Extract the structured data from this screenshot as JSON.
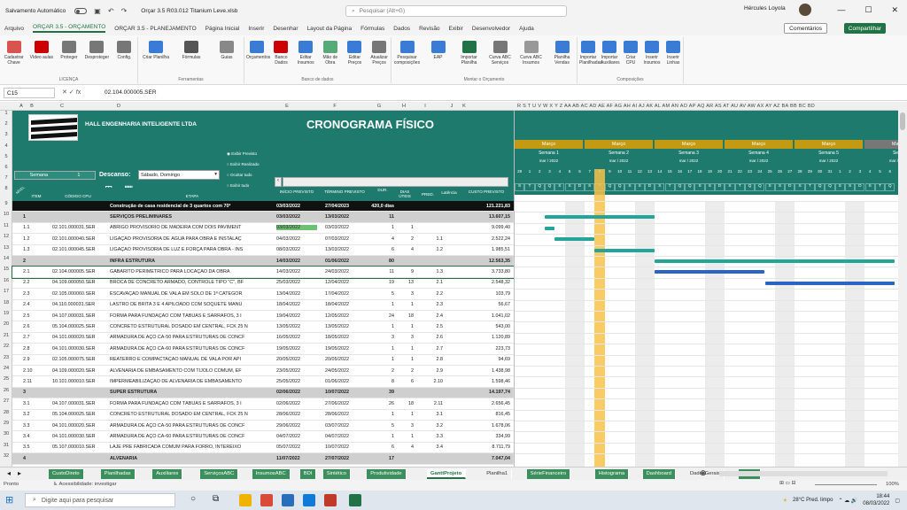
{
  "titlebar": {
    "autosave": "Salvamento Automático",
    "file": "Orçar 3.5 R03.012 Titanium Leve.xlsb",
    "search_placeholder": "Pesquisar (Alt+G)",
    "user": "Hércules Loyola"
  },
  "menu": [
    "Arquivo",
    "ORÇAR 3.5 - ORÇAMENTO",
    "ORÇAR 3.5 - PLANEJAMENTO",
    "Página Inicial",
    "Inserir",
    "Desenhar",
    "Layout da Página",
    "Fórmulas",
    "Dados",
    "Revisão",
    "Exibir",
    "Desenvolvedor",
    "Ajuda"
  ],
  "menu_active": 1,
  "comments": "Comentários",
  "share": "Compartilhar",
  "ribbon": {
    "buttons": [
      {
        "l": "Cadastrar Chave",
        "c": "#d9534f"
      },
      {
        "l": "Vídeo aulas",
        "c": "#c00"
      },
      {
        "l": "Proteger",
        "c": "#777"
      },
      {
        "l": "Desproteger",
        "c": "#777"
      },
      {
        "l": "Config.",
        "c": "#777"
      },
      {
        "l": "Criar Planilha",
        "c": "#3a7bd5"
      },
      {
        "l": "Fórmulas",
        "c": "#555"
      },
      {
        "l": "Guias",
        "c": "#888"
      },
      {
        "l": "Orçamentos",
        "c": "#3a7bd5"
      },
      {
        "l": "Banco Dados",
        "c": "#c00"
      },
      {
        "l": "Editar Insumos",
        "c": "#3a7bd5"
      },
      {
        "l": "Mão de Obra",
        "c": "#5a7"
      },
      {
        "l": "Editar Preços",
        "c": "#3a7bd5"
      },
      {
        "l": "Atualizar Preços",
        "c": "#777"
      },
      {
        "l": "Pesquisar composições",
        "c": "#3a7bd5"
      },
      {
        "l": "EAP",
        "c": "#3a7bd5"
      },
      {
        "l": "Importar Planilha",
        "c": "#217346"
      },
      {
        "l": "Curva ABC Serviços",
        "c": "#777"
      },
      {
        "l": "Curva ABC Insumos",
        "c": "#999"
      },
      {
        "l": "Planilha Vendas",
        "c": "#3a7bd5"
      },
      {
        "l": "Importar Planilhadas",
        "c": "#3a7bd5"
      },
      {
        "l": "Importar Auxiliares",
        "c": "#3a7bd5"
      },
      {
        "l": "Criar CPU",
        "c": "#3a7bd5"
      },
      {
        "l": "Inserir Insumos",
        "c": "#3a7bd5"
      },
      {
        "l": "Inserir Linhas",
        "c": "#3a7bd5"
      }
    ],
    "groups": [
      "LICENÇA",
      "Ferramentas",
      "Banco de dados",
      "Montar o Orçamento",
      "Composições"
    ]
  },
  "formula": {
    "cell": "C15",
    "value": "02.104.000005.SER"
  },
  "cols": [
    "A",
    "B",
    "C",
    "D",
    "E",
    "F",
    "G",
    "H",
    "I",
    "J",
    "K"
  ],
  "gantt_cols": "R S T U V W X Y Z AA AB AC AD AE AF AG AH AI AJ AK AL AM AN AO AP AQ AR AS AT AU AV AW AX AY AZ BA BB BC BD",
  "header": {
    "company": "HALL ENGENHARIA INTELIGENTE LTDA",
    "title": "CRONOGRAMA FÍSICO",
    "semana_label": "Semana",
    "semana_val": "1",
    "descanso_label": "Descanso:",
    "descanso_val": "Sábado, Domingo",
    "opts": [
      "Exibir Previsto",
      "Exibir Realizado",
      "Ocultar tudo",
      "Exibir tudo"
    ],
    "cols": {
      "item": "ITEM",
      "cod": "CÓDIGO CPU",
      "etapa": "ETAPA",
      "ini": "INÍCIO PREVISTO",
      "fim": "TÉRMINO PREVISTO",
      "dur": "DUR.",
      "dias": "DIAS ÚTEIS",
      "pred": "PRED.",
      "lat": "Latência",
      "custo": "CUSTO PREVISTO"
    },
    "nivel": "NÍVEL"
  },
  "gantt_head": {
    "month": "Março",
    "weeks": [
      "Semana 1",
      "Semana 2",
      "Semana 3",
      "Semana 4",
      "Semana 5",
      "Sema"
    ],
    "sub": "mar / 2022",
    "days": [
      "28",
      "1",
      "2",
      "3",
      "4",
      "5",
      "6",
      "7",
      "8",
      "9",
      "10",
      "11",
      "12",
      "13",
      "14",
      "15",
      "16",
      "17",
      "18",
      "19",
      "20",
      "21",
      "22",
      "23",
      "24",
      "25",
      "26",
      "27",
      "28",
      "29",
      "30",
      "31",
      "1",
      "2",
      "3",
      "4",
      "5",
      "6"
    ],
    "letters": [
      "S",
      "T",
      "Q",
      "Q",
      "S",
      "S",
      "D",
      "S",
      "T",
      "Q",
      "Q",
      "S",
      "S",
      "D",
      "S",
      "T",
      "Q",
      "Q",
      "S",
      "S",
      "D",
      "S",
      "T",
      "Q",
      "Q",
      "S",
      "S",
      "D",
      "S",
      "T",
      "Q",
      "Q",
      "S",
      "S",
      "D",
      "S",
      "T",
      "Q"
    ]
  },
  "rows": [
    {
      "t": "top",
      "item": "",
      "cod": "",
      "et": "Construção de casa residencial de 3 quartos com 70²",
      "ini": "03/03/2022",
      "fim": "27/04/2023",
      "dur": "420,0 dias",
      "dias": "",
      "pred": "",
      "custo": "121.221,83"
    },
    {
      "t": "grp",
      "item": "1",
      "cod": "",
      "et": "SERVIÇOS PRELIMINARES",
      "ini": "03/03/2022",
      "fim": "13/03/2022",
      "dur": "11",
      "dias": "",
      "pred": "",
      "custo": "13.607,15"
    },
    {
      "t": "",
      "item": "1.1",
      "cod": "02.101.000031.SER",
      "et": "ABRIGO PROVISÓRIO DE MADEIRA COM DOIS PAVIMENT",
      "ini": "03/03/2022",
      "fim": "03/03/2022",
      "dur": "1",
      "dias": "1",
      "pred": "",
      "custo": "9.099,40"
    },
    {
      "t": "",
      "item": "1.2",
      "cod": "02.101.000040.SER",
      "et": "LIGAÇÃO PROVISÓRIA DE ÁGUA PARA OBRA E INSTALAÇ",
      "ini": "04/03/2022",
      "fim": "07/03/2022",
      "dur": "4",
      "dias": "2",
      "pred": "1.1",
      "custo": "2.522,24"
    },
    {
      "t": "",
      "item": "1.3",
      "cod": "02.101.000045.SER",
      "et": "LIGAÇÃO PROVISÓRIA DE LUZ E FORÇA PARA OBRA - INS",
      "ini": "08/03/2022",
      "fim": "13/03/2022",
      "dur": "6",
      "dias": "4",
      "pred": "1.2",
      "custo": "1.985,51"
    },
    {
      "t": "grp",
      "item": "2",
      "cod": "",
      "et": "INFRA ESTRUTURA",
      "ini": "14/03/2022",
      "fim": "01/06/2022",
      "dur": "80",
      "dias": "",
      "pred": "",
      "custo": "12.563,35"
    },
    {
      "t": "",
      "item": "2.1",
      "cod": "02.104.000005.SER",
      "et": "GABARITO PERIMÉTRICO PARA LOCAÇÃO DA OBRA",
      "ini": "14/03/2022",
      "fim": "24/03/2022",
      "dur": "11",
      "dias": "9",
      "pred": "1.3",
      "custo": "3.733,80"
    },
    {
      "t": "",
      "item": "2.2",
      "cod": "04.109.000050.SER",
      "et": "BROCA DE CONCRETO ARMADO, CONTROLE TIPO \"C\", BF",
      "ini": "25/03/2022",
      "fim": "12/04/2022",
      "dur": "19",
      "dias": "13",
      "pred": "2.1",
      "custo": "2.548,32"
    },
    {
      "t": "",
      "item": "2.3",
      "cod": "02.105.000060.SER",
      "et": "ESCAVAÇÃO MANUAL DE VALA EM SOLO DE 1ª CATEGOR",
      "ini": "13/04/2022",
      "fim": "17/04/2022",
      "dur": "5",
      "dias": "3",
      "pred": "2.2",
      "custo": "103,79"
    },
    {
      "t": "",
      "item": "2.4",
      "cod": "04.110.000031.SER",
      "et": "LASTRO DE BRITA 3 E 4 APILOADO COM SOQUETE MANU",
      "ini": "18/04/2022",
      "fim": "18/04/2022",
      "dur": "1",
      "dias": "1",
      "pred": "2.3",
      "custo": "56,67"
    },
    {
      "t": "",
      "item": "2.5",
      "cod": "04.107.000031.SER",
      "et": "FORMA PARA FUNDAÇÃO COM TÁBUAS E SARRAFOS, 3 I",
      "ini": "19/04/2022",
      "fim": "12/05/2022",
      "dur": "24",
      "dias": "18",
      "pred": "2.4",
      "custo": "1.041,02"
    },
    {
      "t": "",
      "item": "2.6",
      "cod": "05.104.000025.SER",
      "et": "CONCRETO ESTRUTURAL DOSADO EM CENTRAL, FCK 25 N",
      "ini": "13/05/2022",
      "fim": "13/05/2022",
      "dur": "1",
      "dias": "1",
      "pred": "2.5",
      "custo": "543,00"
    },
    {
      "t": "",
      "item": "2.7",
      "cod": "04.101.000020.SER",
      "et": "ARMADURA DE AÇO CA-50 PARA ESTRUTURAS DE CONCF",
      "ini": "16/05/2022",
      "fim": "18/05/2022",
      "dur": "3",
      "dias": "3",
      "pred": "2.6",
      "custo": "1.120,89"
    },
    {
      "t": "",
      "item": "2.8",
      "cod": "04.101.000030.SER",
      "et": "ARMADURA DE AÇO CA-60 PARA ESTRUTURAS DE CONCF",
      "ini": "19/05/2022",
      "fim": "19/05/2022",
      "dur": "1",
      "dias": "1",
      "pred": "2.7",
      "custo": "223,73"
    },
    {
      "t": "",
      "item": "2.9",
      "cod": "02.105.000075.SER",
      "et": "REATERRO E COMPACTAÇÃO MANUAL DE VALA POR API",
      "ini": "20/05/2022",
      "fim": "20/05/2022",
      "dur": "1",
      "dias": "1",
      "pred": "2.8",
      "custo": "94,69"
    },
    {
      "t": "",
      "item": "2.10",
      "cod": "04.109.000020.SER",
      "et": "ALVENARIA DE EMBASAMENTO COM TIJOLO COMUM, EF",
      "ini": "23/05/2022",
      "fim": "24/05/2022",
      "dur": "2",
      "dias": "2",
      "pred": "2.9",
      "custo": "1.438,98"
    },
    {
      "t": "",
      "item": "2.11",
      "cod": "10.101.000010.SER",
      "et": "IMPERMEABILIZAÇÃO DE ALVENARIA DE EMBASAMENTO",
      "ini": "25/05/2022",
      "fim": "01/06/2022",
      "dur": "8",
      "dias": "6",
      "pred": "2.10",
      "custo": "1.598,46"
    },
    {
      "t": "grp",
      "item": "3",
      "cod": "",
      "et": "SUPER ESTRUTURA",
      "ini": "02/06/2022",
      "fim": "10/07/2022",
      "dur": "39",
      "dias": "",
      "pred": "",
      "custo": "14.197,74"
    },
    {
      "t": "",
      "item": "3.1",
      "cod": "04.107.000031.SER",
      "et": "FORMA PARA FUNDAÇÃO COM TÁBUAS E SARRAFOS, 3 I",
      "ini": "02/06/2022",
      "fim": "27/06/2022",
      "dur": "26",
      "dias": "18",
      "pred": "2.11",
      "custo": "2.656,45"
    },
    {
      "t": "",
      "item": "3.2",
      "cod": "05.104.000025.SER",
      "et": "CONCRETO ESTRUTURAL DOSADO EM CENTRAL, FCK 25 N",
      "ini": "28/06/2022",
      "fim": "28/06/2022",
      "dur": "1",
      "dias": "1",
      "pred": "3.1",
      "custo": "816,45"
    },
    {
      "t": "",
      "item": "3.3",
      "cod": "04.101.000020.SER",
      "et": "ARMADURA DE AÇO CA-50 PARA ESTRUTURAS DE CONCF",
      "ini": "29/06/2022",
      "fim": "03/07/2022",
      "dur": "5",
      "dias": "3",
      "pred": "3.2",
      "custo": "1.678,06"
    },
    {
      "t": "",
      "item": "3.4",
      "cod": "04.101.000030.SER",
      "et": "ARMADURA DE AÇO CA-60 PARA ESTRUTURAS DE CONCF",
      "ini": "04/07/2022",
      "fim": "04/07/2022",
      "dur": "1",
      "dias": "1",
      "pred": "3.3",
      "custo": "334,99"
    },
    {
      "t": "",
      "item": "3.5",
      "cod": "05.107.000010.SER",
      "et": "LAJE PRÉ FABRICADA COMUM PARA FORRO, INTEREIXO",
      "ini": "05/07/2022",
      "fim": "10/07/2022",
      "dur": "6",
      "dias": "4",
      "pred": "3.4",
      "custo": "8.711,79"
    },
    {
      "t": "grp",
      "item": "4",
      "cod": "",
      "et": "ALVENARIA",
      "ini": "11/07/2022",
      "fim": "27/07/2022",
      "dur": "17",
      "dias": "",
      "pred": "",
      "custo": "7.047,04"
    }
  ],
  "row_numbers": [
    "9",
    "10",
    "11",
    "12",
    "13",
    "14",
    "15",
    "16",
    "17",
    "18",
    "19",
    "20",
    "21",
    "22",
    "23",
    "24",
    "25",
    "26",
    "27",
    "28",
    "29",
    "30",
    "31",
    "32"
  ],
  "tabs": [
    "CustoDireto",
    "Planilhadas",
    "Auxiliares",
    "ServiçosABC",
    "InsumosABC",
    "BDI",
    "Sintético",
    "Produtividade",
    "GanttProjeto",
    "Planilha1",
    "SérieFinanceiro",
    "Histograma",
    "Dashboard",
    "DadosGerais",
    "Ban ..."
  ],
  "tab_active": 8,
  "status": {
    "ready": "Pronto",
    "access": "Acessibilidade: investigar",
    "zoom": "100%"
  },
  "taskbar": {
    "search": "Digite aqui para pesquisar",
    "weather": "28°C  Pred. limpo",
    "time": "18:44",
    "date": "08/03/2022"
  }
}
